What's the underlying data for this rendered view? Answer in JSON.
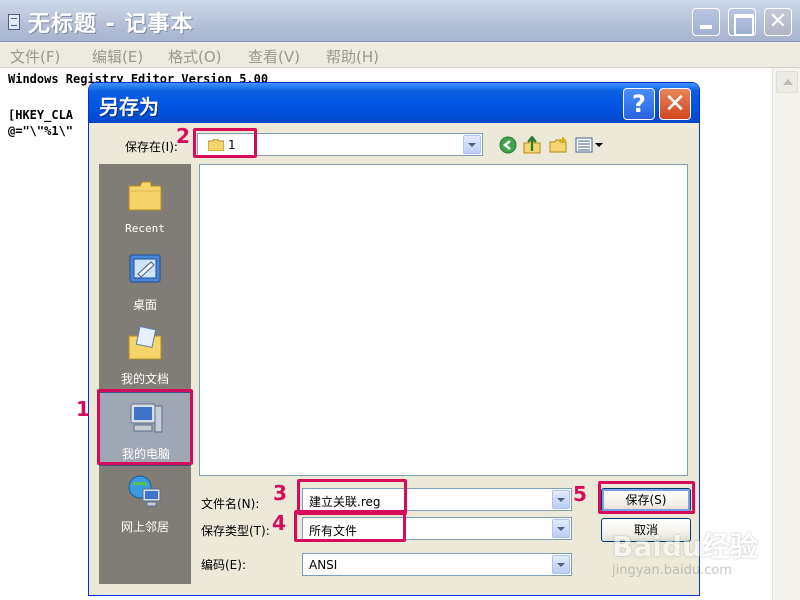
{
  "notepad": {
    "title": "无标题 - 记事本",
    "menus": [
      "文件(F)",
      "编辑(E)",
      "格式(O)",
      "查看(V)",
      "帮助(H)"
    ],
    "lines": [
      "Windows Registry Editor Version 5.00",
      "",
      "[HKEY_CLA",
      "@=\"\\\"%1\\\""
    ]
  },
  "dialog": {
    "title": "另存为",
    "help_label": "?",
    "close_label": "✕",
    "save_in_label": "保存在(I):",
    "save_in_value": "1",
    "places": [
      {
        "label": "Recent",
        "icon": "recent-folder-icon"
      },
      {
        "label": "桌面",
        "icon": "desktop-icon"
      },
      {
        "label": "我的文档",
        "icon": "my-documents-icon"
      },
      {
        "label": "我的电脑",
        "icon": "my-computer-icon"
      },
      {
        "label": "网上邻居",
        "icon": "network-places-icon"
      }
    ],
    "filename_label": "文件名(N):",
    "filename_value": "建立关联.reg",
    "filetype_label": "保存类型(T):",
    "filetype_value": "所有文件",
    "encoding_label": "编码(E):",
    "encoding_value": "ANSI",
    "save_button": "保存(S)",
    "cancel_button": "取消"
  },
  "annotations": [
    "1",
    "2",
    "3",
    "4",
    "5"
  ],
  "watermark": {
    "logo": "Baidu经验",
    "sub": "jingyan.baidu.com"
  },
  "colors": {
    "annotation": "#d80b5a",
    "dialog_title": "#0054e3",
    "places_bar": "#807d76"
  }
}
